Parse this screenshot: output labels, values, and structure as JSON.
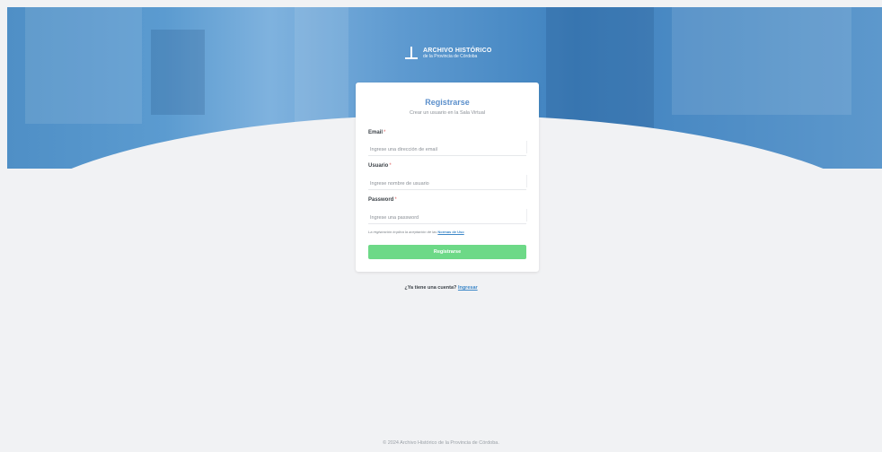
{
  "logo": {
    "title": "ARCHIVO HISTÓRICO",
    "subtitle": "de la Provincia de Córdoba"
  },
  "form": {
    "title": "Registrarse",
    "subtitle": "Crear un usuario en la Sala Virtual",
    "email": {
      "label": "Email",
      "placeholder": "Ingrese una dirección de email"
    },
    "usuario": {
      "label": "Usuario",
      "placeholder": "Ingrese nombre de usuario"
    },
    "password": {
      "label": "Password",
      "placeholder": "Ingrese una password"
    },
    "required_marker": "*",
    "terms_text": "La registración implica la aceptación de las ",
    "terms_link": "Normas de Uso",
    "submit_label": "Registrarse"
  },
  "login_prompt": {
    "text": "¿Ya tiene una cuenta? ",
    "link": "Ingresar"
  },
  "footer": {
    "text": "© 2024 Archivo Histórico de la Provincia de Córdoba."
  },
  "colors": {
    "hero": "#4f8fc6",
    "accent": "#5b8fcb",
    "button": "#6dd987",
    "link": "#3c87c8",
    "required": "#e06464",
    "background": "#f1f2f4"
  }
}
